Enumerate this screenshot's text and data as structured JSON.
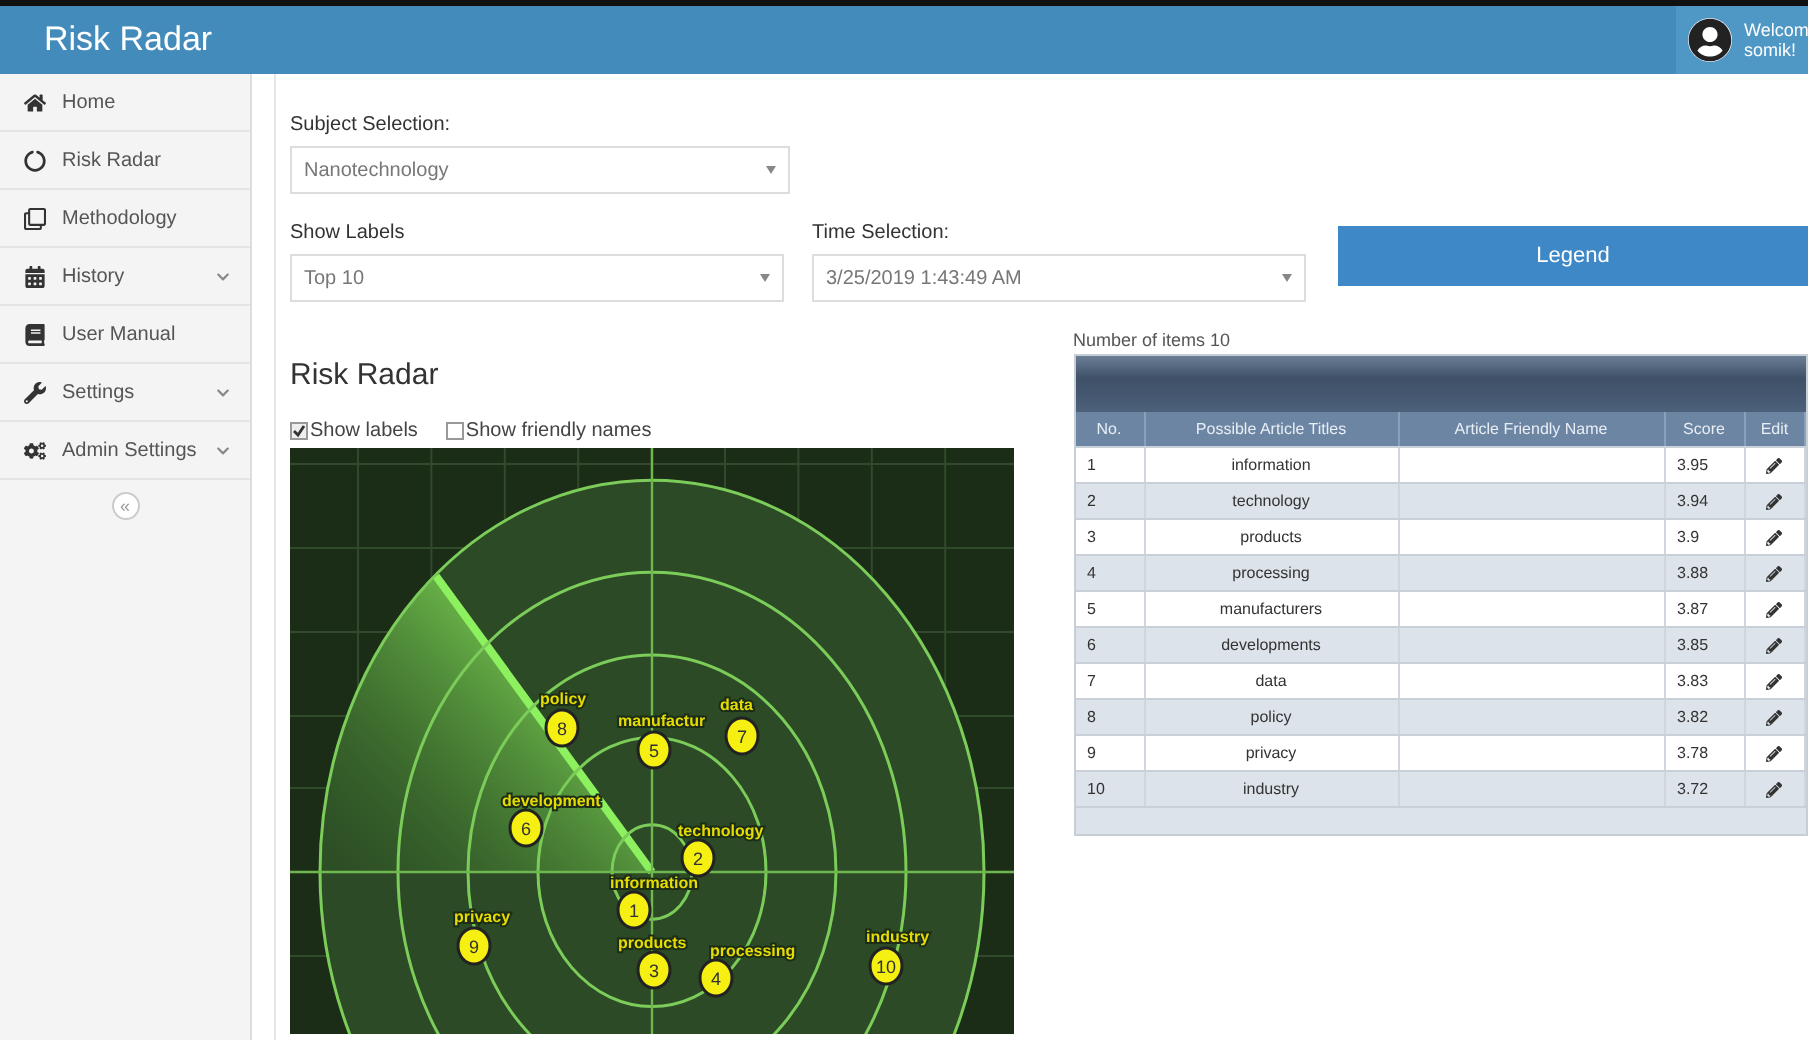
{
  "header": {
    "title": "Risk Radar",
    "greeting": "Welcom",
    "user_name": "somik!"
  },
  "sidebar": {
    "items": [
      {
        "label": "Home",
        "expandable": false
      },
      {
        "label": "Risk Radar",
        "expandable": false
      },
      {
        "label": "Methodology",
        "expandable": false
      },
      {
        "label": "History",
        "expandable": true
      },
      {
        "label": "User Manual",
        "expandable": false
      },
      {
        "label": "Settings",
        "expandable": true
      },
      {
        "label": "Admin Settings",
        "expandable": true
      }
    ],
    "collapse_button": "«"
  },
  "form": {
    "subject": {
      "label": "Subject Selection:",
      "value": "Nanotechnology"
    },
    "show_labels": {
      "label": "Show Labels",
      "value": "Top 10"
    },
    "time": {
      "label": "Time Selection:",
      "value": "3/25/2019 1:43:49 AM"
    },
    "legend_button": "Legend"
  },
  "radar": {
    "title": "Risk Radar",
    "options": [
      {
        "label": "Show labels",
        "checked": true
      },
      {
        "label": "Show friendly names",
        "checked": false
      }
    ],
    "blips": [
      {
        "number": "1",
        "label": "information"
      },
      {
        "number": "2",
        "label": "technology"
      },
      {
        "number": "3",
        "label": "products"
      },
      {
        "number": "4",
        "label": "processing"
      },
      {
        "number": "5",
        "label": "manufactur"
      },
      {
        "number": "6",
        "label": "development"
      },
      {
        "number": "7",
        "label": "data"
      },
      {
        "number": "8",
        "label": "policy"
      },
      {
        "number": "9",
        "label": "privacy"
      },
      {
        "number": "10",
        "label": "industry"
      }
    ]
  },
  "table": {
    "count_label": "Number of items  10",
    "columns": [
      "No.",
      "Possible Article Titles",
      "Article Friendly Name",
      "Score",
      "Edit"
    ],
    "rows": [
      {
        "no": "1",
        "title": "information",
        "score": "3.95"
      },
      {
        "no": "2",
        "title": "technology",
        "score": "3.94"
      },
      {
        "no": "3",
        "title": "products",
        "score": "3.9"
      },
      {
        "no": "4",
        "title": "processing",
        "score": "3.88"
      },
      {
        "no": "5",
        "title": "manufacturers",
        "score": "3.87"
      },
      {
        "no": "6",
        "title": "developments",
        "score": "3.85"
      },
      {
        "no": "7",
        "title": "data",
        "score": "3.83"
      },
      {
        "no": "8",
        "title": "policy",
        "score": "3.82"
      },
      {
        "no": "9",
        "title": "privacy",
        "score": "3.78"
      },
      {
        "no": "10",
        "title": "industry",
        "score": "3.72"
      }
    ]
  }
}
